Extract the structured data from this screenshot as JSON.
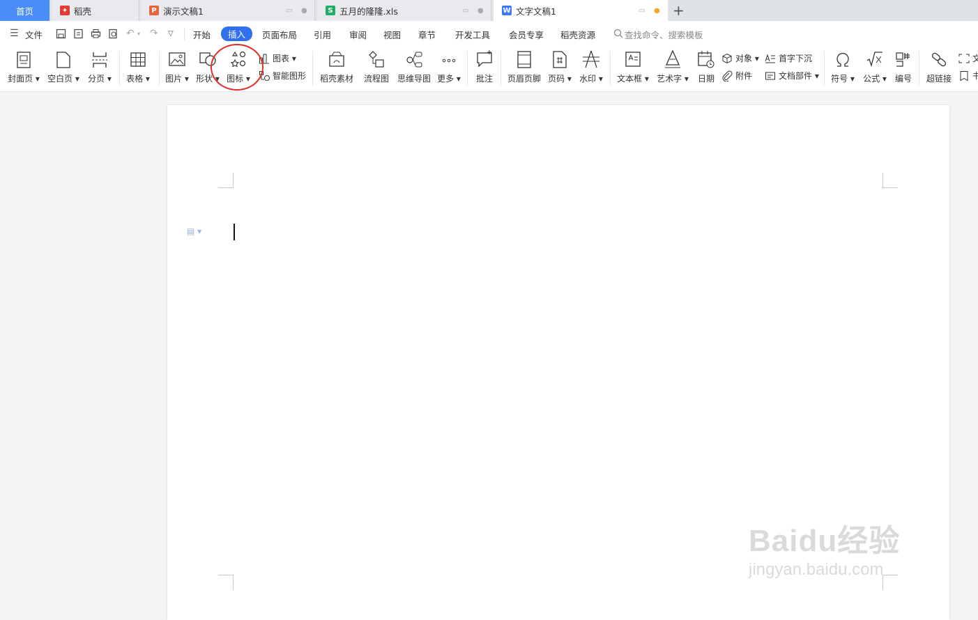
{
  "tabs": {
    "home": "首页",
    "daoke": "稻壳",
    "ppt": "演示文稿1",
    "xls": "五月的隆隆.xls",
    "doc": "文字文稿1"
  },
  "menu": {
    "file": "文件",
    "items": [
      "开始",
      "插入",
      "页面布局",
      "引用",
      "审阅",
      "视图",
      "章节",
      "开发工具",
      "会员专享",
      "稻壳资源"
    ],
    "search_placeholder": "查找命令、搜索模板"
  },
  "ribbon": {
    "cover": "封面页",
    "blank": "空白页",
    "pagebreak": "分页",
    "table": "表格",
    "picture": "图片",
    "shape": "形状",
    "icon": "图标",
    "chart": "图表",
    "smartart": "智能图形",
    "material": "稻壳素材",
    "flowchart": "流程图",
    "mindmap": "思维导图",
    "more": "更多",
    "comment": "批注",
    "header_footer": "页眉页脚",
    "page_number": "页码",
    "watermark": "水印",
    "textbox": "文本框",
    "wordart": "艺术字",
    "date": "日期",
    "object": "对象",
    "attachment": "附件",
    "dropcap": "首字下沉",
    "docpart": "文档部件",
    "symbol": "符号",
    "formula": "公式",
    "numbering": "编号",
    "hyperlink": "超链接",
    "cut1": "文",
    "cut2": "书"
  },
  "watermark_text": {
    "logo": "Baidu经验",
    "url": "jingyan.baidu.com"
  },
  "colors": {
    "accent": "#2f6ff0",
    "home_tab": "#4b8df8",
    "highlight_circle": "#e0302a",
    "ppt_icon": "#e8643c",
    "xls_icon": "#1fae66",
    "doc_icon": "#3e7cf5",
    "daoke_icon": "#e53935",
    "unsaved_dot": "#f5a623"
  }
}
